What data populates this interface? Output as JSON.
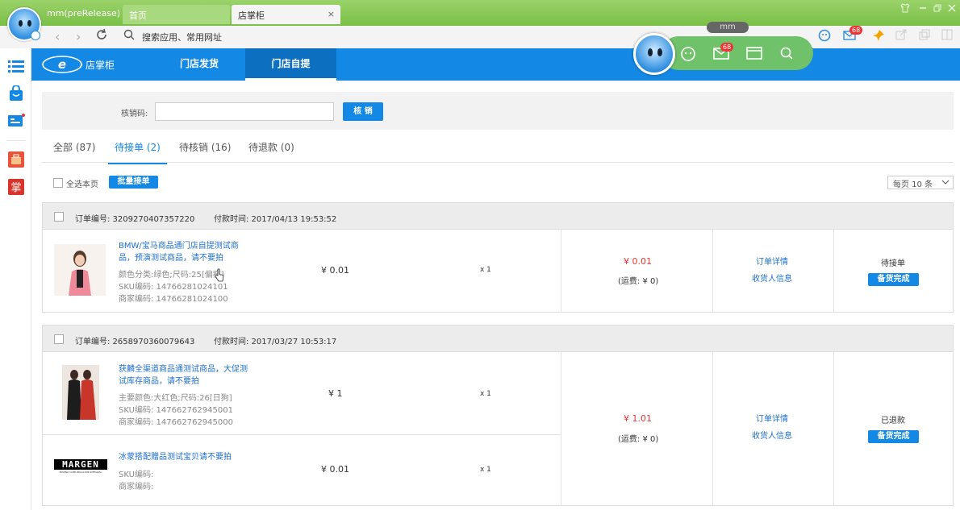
{
  "browser": {
    "app_name": "mm(preRelease)",
    "tabs": [
      {
        "label": "首页"
      },
      {
        "label": "店掌柜"
      }
    ],
    "address_placeholder": "搜索应用、常用网址",
    "mm_label": "mm",
    "mail_badge": "68",
    "mm_widget_badge": "68"
  },
  "header": {
    "logo_text": "店掌柜",
    "nav": [
      {
        "label": "门店发货"
      },
      {
        "label": "门店自提"
      }
    ]
  },
  "filter": {
    "code_label": "核销码:",
    "code_value": "",
    "verify_button": "核 销"
  },
  "status_tabs": [
    {
      "label": "全部 (87)"
    },
    {
      "label": "待接单 (2)"
    },
    {
      "label": "待核销 (16)"
    },
    {
      "label": "待退款 (0)"
    }
  ],
  "toolbar": {
    "select_all": "全选本页",
    "batch_accept": "批量接单",
    "page_size": "每页 10 条"
  },
  "orders": [
    {
      "order_no": "订单编号: 3209270407357220",
      "pay_time": "付款时间: 2017/04/13 19:53:52",
      "items": [
        {
          "title1": "BMW/宝马商品通门店自提测试商",
          "title2": "品，预演测试商品，请不要拍",
          "attrs": "颜色分类:绿色;尺码:25[偏瘦]",
          "sku": "SKU编码: 14766281024101",
          "merchant": "商家编码: 14766281024100",
          "price": "¥ 0.01",
          "qty": "x 1"
        }
      ],
      "total": "¥ 0.01",
      "shipping": "(运费: ¥ 0)",
      "actions": [
        "订单详情",
        "收货人信息"
      ],
      "status": "待接单",
      "status_button": "备货完成"
    },
    {
      "order_no": "订单编号: 2658970360079643",
      "pay_time": "付款时间: 2017/03/27 10:53:17",
      "items": [
        {
          "title1": "获麟全渠道商品通测试商品，大促测",
          "title2": "试库存商品，请不要拍",
          "attrs": "主要颜色:大红色;尺码:26[日狗]",
          "sku": "SKU编码: 147662762945001",
          "merchant": "商家编码: 147662762945000",
          "price": "¥ 1",
          "qty": "x 1"
        },
        {
          "title1": "冰蒙搭配赠品测试宝贝请不要拍",
          "title2": "",
          "attrs": "",
          "sku": "SKU编码:",
          "merchant": "商家编码:",
          "price": "¥ 0.01",
          "qty": "x 1",
          "brand_logo": "MARGEN",
          "brand_sub": "DISEÑO COMUNICACIÓN INTEGRAL"
        }
      ],
      "total": "¥ 1.01",
      "shipping": "(运费: ¥ 0)",
      "actions": [
        "订单详情",
        "收货人信息"
      ],
      "status": "已退款",
      "status_button": "备货完成"
    }
  ]
}
